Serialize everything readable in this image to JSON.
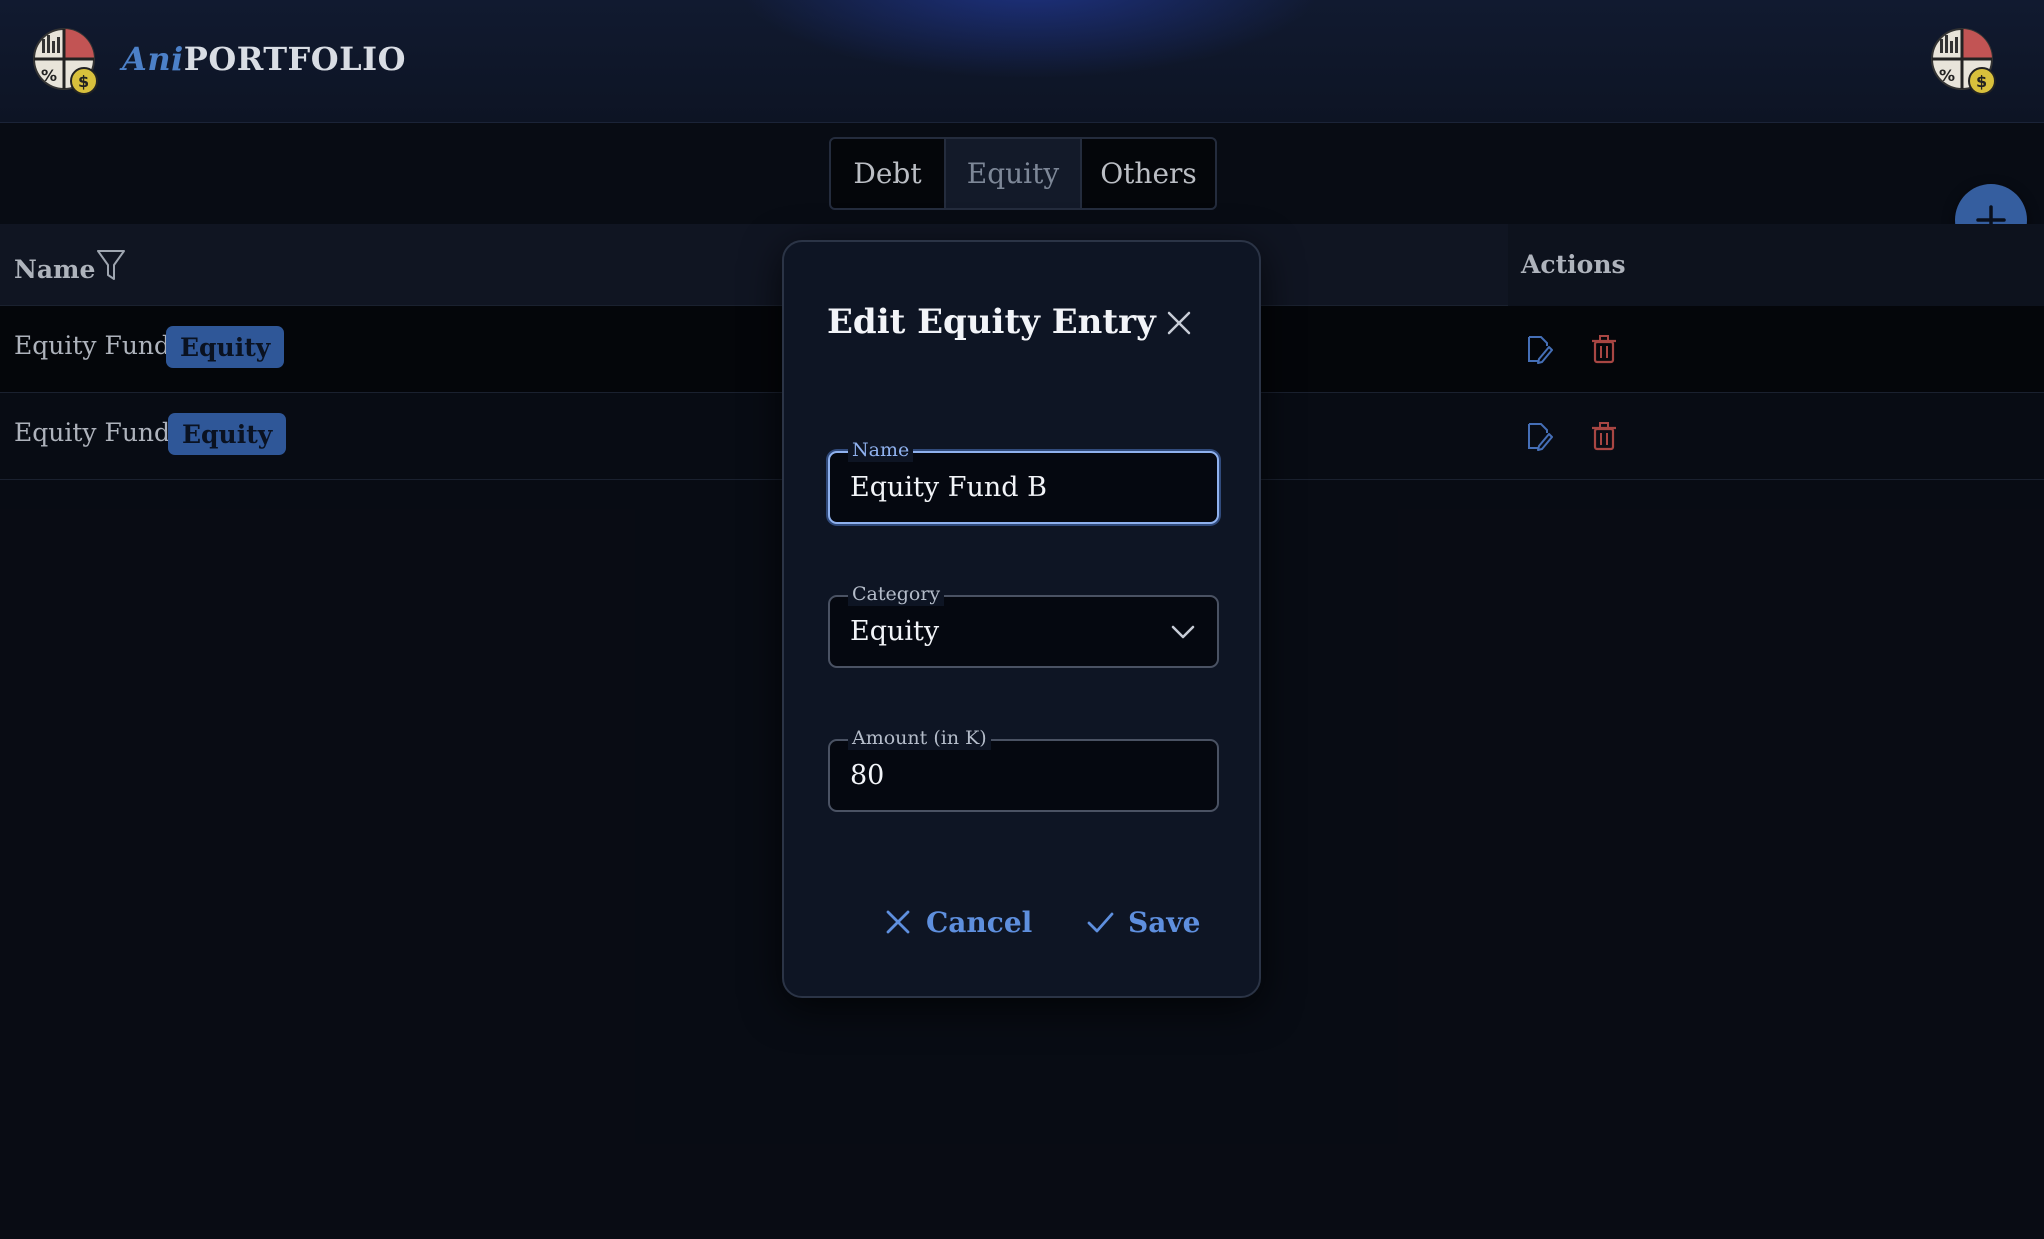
{
  "app": {
    "brand_prefix": "Ani",
    "brand_suffix": "PORTFOLIO"
  },
  "tabs": [
    {
      "label": "Debt",
      "selected": false
    },
    {
      "label": "Equity",
      "selected": true
    },
    {
      "label": "Others",
      "selected": false
    }
  ],
  "table": {
    "columns": {
      "name": "Name",
      "actions": "Actions"
    },
    "rows": [
      {
        "name": "Equity Fund A",
        "category": "Equity"
      },
      {
        "name": "Equity Fund B",
        "category": "Equity"
      }
    ]
  },
  "dialog": {
    "title": "Edit Equity Entry",
    "fields": {
      "name": {
        "label": "Name",
        "value": "Equity Fund B"
      },
      "category": {
        "label": "Category",
        "value": "Equity"
      },
      "amount": {
        "label": "Amount (in K)",
        "value": "80"
      }
    },
    "cancel_label": "Cancel",
    "save_label": "Save"
  },
  "colors": {
    "accent": "#5e8fde",
    "badge": "#3663ad",
    "delete": "#c0504d",
    "background": "#0a0e17"
  },
  "icons": {
    "logo": "portfolio-pie-logo-icon",
    "filter": "filter-icon",
    "edit": "edit-icon",
    "delete": "trash-icon",
    "add": "plus-icon",
    "close": "close-icon",
    "dropdown": "chevron-down-icon",
    "save": "check-icon"
  }
}
